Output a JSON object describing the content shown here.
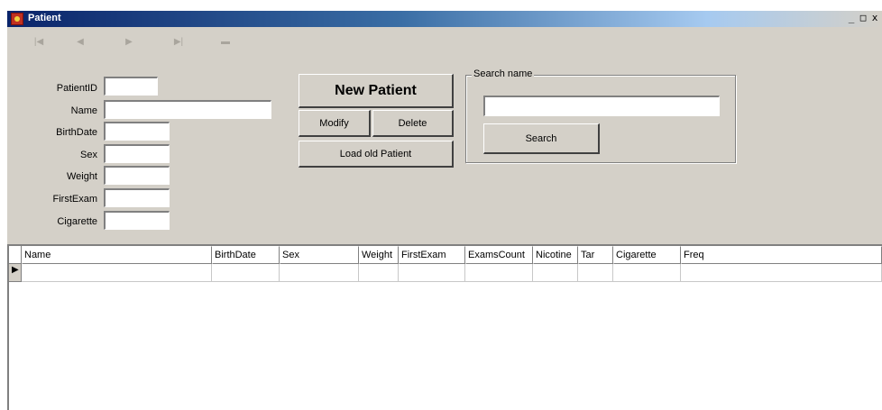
{
  "window": {
    "title": "Patient",
    "icon": "patient-app-icon",
    "buttons": {
      "minimize": "_",
      "maximize": "□",
      "close": "x"
    }
  },
  "navigator": {
    "first": "first-record-icon",
    "prior": "prior-record-icon",
    "next": "next-record-icon",
    "last": "last-record-icon",
    "insert": "insert-record-icon"
  },
  "form": {
    "patient_id": {
      "label": "PatientID",
      "value": ""
    },
    "name": {
      "label": "Name",
      "value": ""
    },
    "birthdate": {
      "label": "BirthDate",
      "value": ""
    },
    "sex": {
      "label": "Sex",
      "value": ""
    },
    "weight": {
      "label": "Weight",
      "value": ""
    },
    "first_exam": {
      "label": "FirstExam",
      "value": ""
    },
    "cigarette": {
      "label": "Cigarette",
      "value": ""
    }
  },
  "actions": {
    "new_patient": "New Patient",
    "modify": "Modify",
    "delete": "Delete",
    "load_old": "Load old Patient"
  },
  "search": {
    "legend": "Search name",
    "value": "",
    "button": "Search"
  },
  "grid": {
    "columns": [
      "Name",
      "BirthDate",
      "Sex",
      "Weight",
      "FirstExam",
      "ExamsCount",
      "Nicotine",
      "Tar",
      "Cigarette",
      "Freq"
    ],
    "row_indicator": "▶",
    "rows": [
      [
        "",
        "",
        "",
        "",
        "",
        "",
        "",
        "",
        "",
        ""
      ]
    ]
  }
}
